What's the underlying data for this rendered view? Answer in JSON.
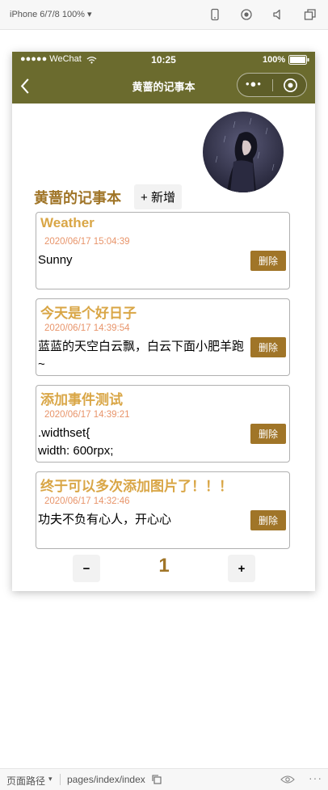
{
  "simulator": {
    "device": "iPhone 6/7/8 100% ▾"
  },
  "status_bar": {
    "carrier": "●●●●● WeChat",
    "time": "10:25",
    "battery": "100%"
  },
  "nav": {
    "title": "黄蔷的记事本",
    "more": "•●•"
  },
  "header": {
    "notebook_title": "黄蔷的记事本",
    "add_label": "+ 新增"
  },
  "notes": [
    {
      "title": "Weather",
      "time": "2020/06/17 15:04:39",
      "body": "Sunny",
      "delete_label": "删除"
    },
    {
      "title": "今天是个好日子",
      "time": "2020/06/17 14:39:54",
      "body": "蓝蓝的天空白云飘，白云下面小肥羊跑~",
      "delete_label": "删除"
    },
    {
      "title": "添加事件测试",
      "time": "2020/06/17 14:39:21",
      "body_line1": ".widthset{",
      "body_line2": "width: 600rpx;",
      "delete_label": "删除"
    },
    {
      "title": "终于可以多次添加图片了！！！",
      "time": "2020/06/17 14:32:46",
      "body": "功夫不负有心人，开心心",
      "delete_label": "删除"
    }
  ],
  "pager": {
    "prev_label": "−",
    "page": "1",
    "next_label": "+"
  },
  "bottom_bar": {
    "path_label": "页面路径",
    "path": "pages/index/index"
  },
  "colors": {
    "nav_background": "#6b6b2e",
    "accent": "#a07528",
    "note_title": "#d9a646",
    "note_time": "#e8946a"
  }
}
